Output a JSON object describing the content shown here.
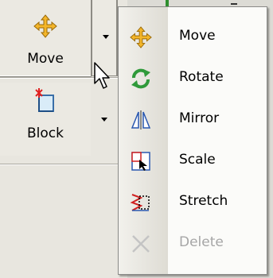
{
  "toolbar": {
    "move_button": {
      "label": "Move",
      "icon": "move-arrows-icon"
    },
    "block_button": {
      "label": "Block",
      "icon": "block-insert-icon"
    }
  },
  "menu": {
    "items": [
      {
        "label": "Move",
        "icon": "move-arrows-icon",
        "enabled": true
      },
      {
        "label": "Rotate",
        "icon": "rotate-icon",
        "enabled": true
      },
      {
        "label": "Mirror",
        "icon": "mirror-icon",
        "enabled": true
      },
      {
        "label": "Scale",
        "icon": "scale-icon",
        "enabled": true
      },
      {
        "label": "Stretch",
        "icon": "stretch-icon",
        "enabled": true
      },
      {
        "label": "Delete",
        "icon": "delete-icon",
        "enabled": false
      }
    ]
  },
  "colors": {
    "toolbar_bg": "#ebe9e2",
    "menu_bg": "#fbfbf9",
    "menu_strip": "#dedcd4",
    "disabled_text": "#a6a6a6",
    "accent_green": "#2f9a3a",
    "accent_orange": "#f0a020"
  }
}
